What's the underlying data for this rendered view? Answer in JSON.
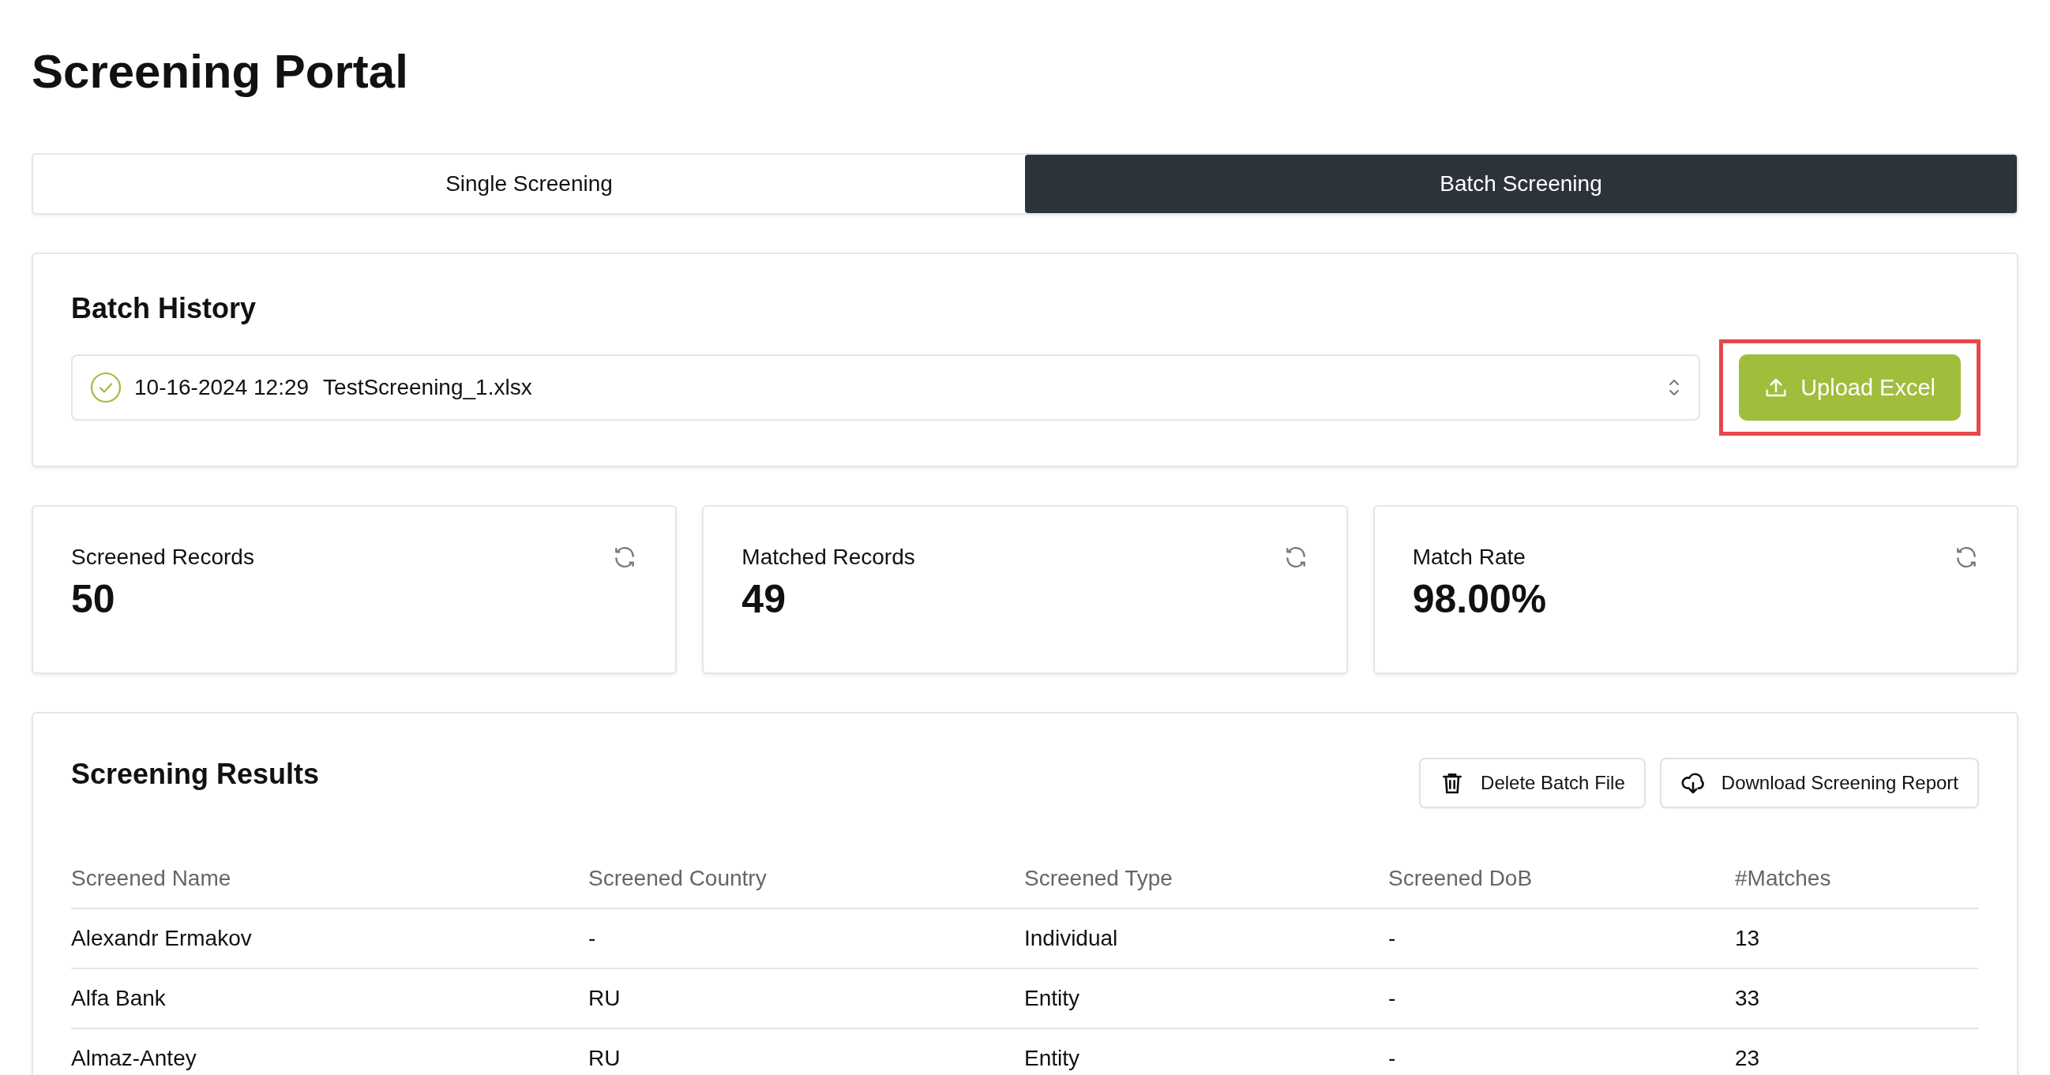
{
  "title": "Screening Portal",
  "tabs": [
    {
      "label": "Single Screening",
      "selected": false
    },
    {
      "label": "Batch Screening",
      "selected": true
    }
  ],
  "batch_history": {
    "heading": "Batch History",
    "selector": {
      "date": "10-16-2024 12:29",
      "file": "TestScreening_1.xlsx"
    },
    "upload_button": {
      "label": "Upload Excel",
      "highlighted": true
    }
  },
  "stats": [
    {
      "label": "Screened Records",
      "value": "50"
    },
    {
      "label": "Matched Records",
      "value": "49"
    },
    {
      "label": "Match Rate",
      "value": "98.00%"
    }
  ],
  "results": {
    "heading": "Screening Results",
    "buttons": [
      {
        "label": "Delete Batch File",
        "kind": "delete"
      },
      {
        "label": "Download Screening Report",
        "kind": "download"
      }
    ],
    "table": {
      "columns": [
        "Screened Name",
        "Screened Country",
        "Screened Type",
        "Screened DoB",
        "#Matches"
      ],
      "rows": [
        [
          "Alexandr Ermakov",
          "-",
          "Individual",
          "-",
          "13"
        ],
        [
          "Alfa Bank",
          "RU",
          "Entity",
          "-",
          "33"
        ],
        [
          "Almaz-Antey",
          "RU",
          "Entity",
          "-",
          "23"
        ]
      ]
    }
  }
}
